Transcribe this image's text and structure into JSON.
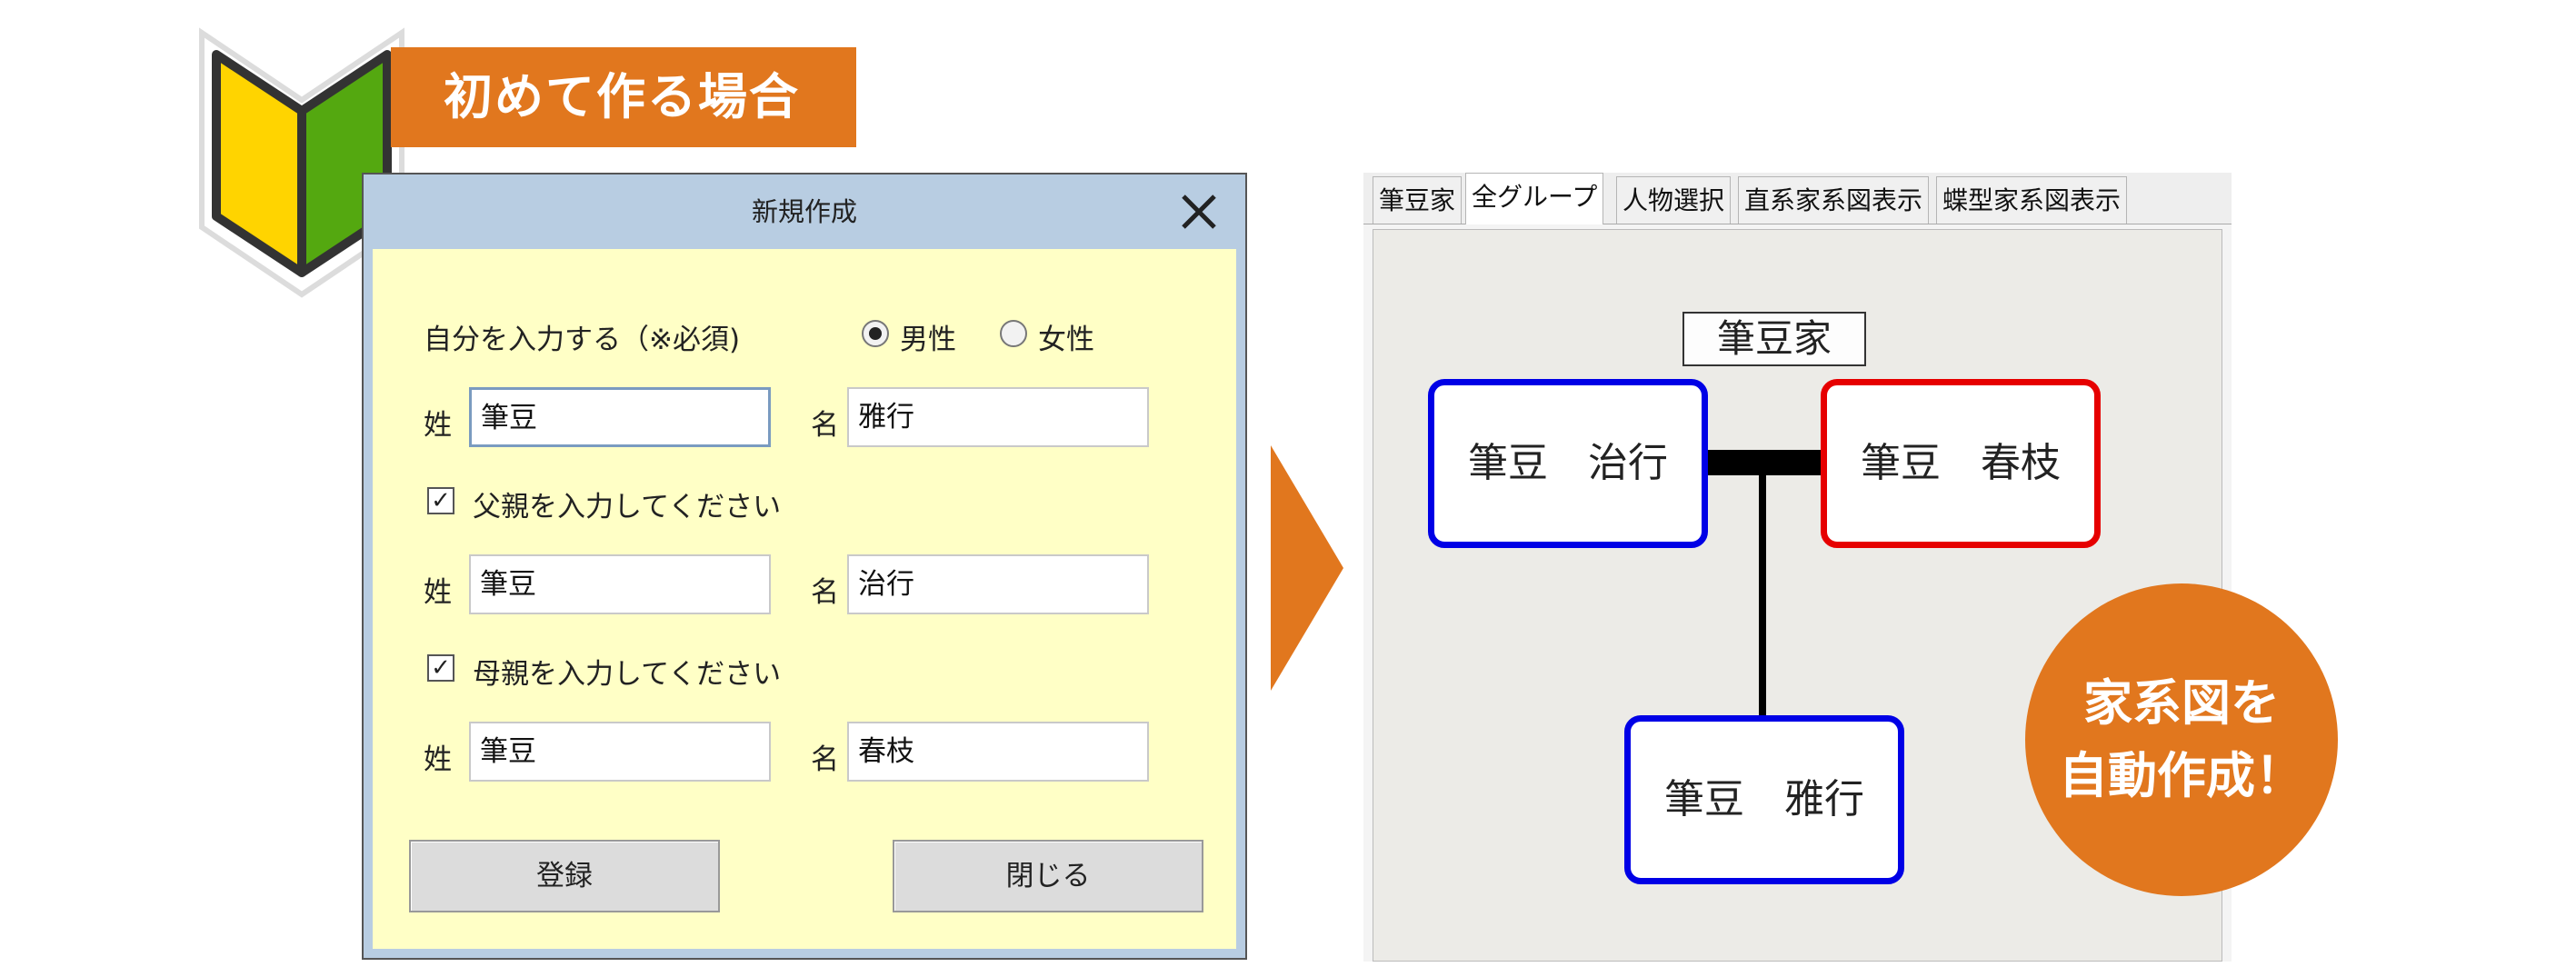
{
  "banner": {
    "text": "初めて作る場合"
  },
  "colors": {
    "accent_orange": "#e1771e",
    "dialog_body": "#ffffc6",
    "title_bar": "#b8cde2",
    "male_border": "#0000e6",
    "female_border": "#e60000"
  },
  "dialog": {
    "title": "新規作成",
    "self_label": "自分を入力する（※必須)",
    "gender": {
      "male": "男性",
      "female": "女性",
      "selected": "男性"
    },
    "self": {
      "surname_label": "姓",
      "surname": "筆豆",
      "given_label": "名",
      "given": "雅行"
    },
    "father": {
      "checkbox_label": "父親を入力してください",
      "checked": true,
      "surname_label": "姓",
      "surname": "筆豆",
      "given_label": "名",
      "given": "治行"
    },
    "mother": {
      "checkbox_label": "母親を入力してください",
      "checked": true,
      "surname_label": "姓",
      "surname": "筆豆",
      "given_label": "名",
      "given": "春枝"
    },
    "register_button": "登録",
    "close_button": "閉じる",
    "checkmark": "✓"
  },
  "app": {
    "tabs": [
      "筆豆家",
      "全グループ",
      "人物選択",
      "直系家系図表示",
      "蝶型家系図表示"
    ],
    "active_tab": "全グループ",
    "family_name": "筆豆家",
    "persons": {
      "father": "筆豆　治行",
      "mother": "筆豆　春枝",
      "child": "筆豆　雅行"
    }
  },
  "badge": {
    "line1": "家系図を",
    "line2": "自動作成！"
  }
}
